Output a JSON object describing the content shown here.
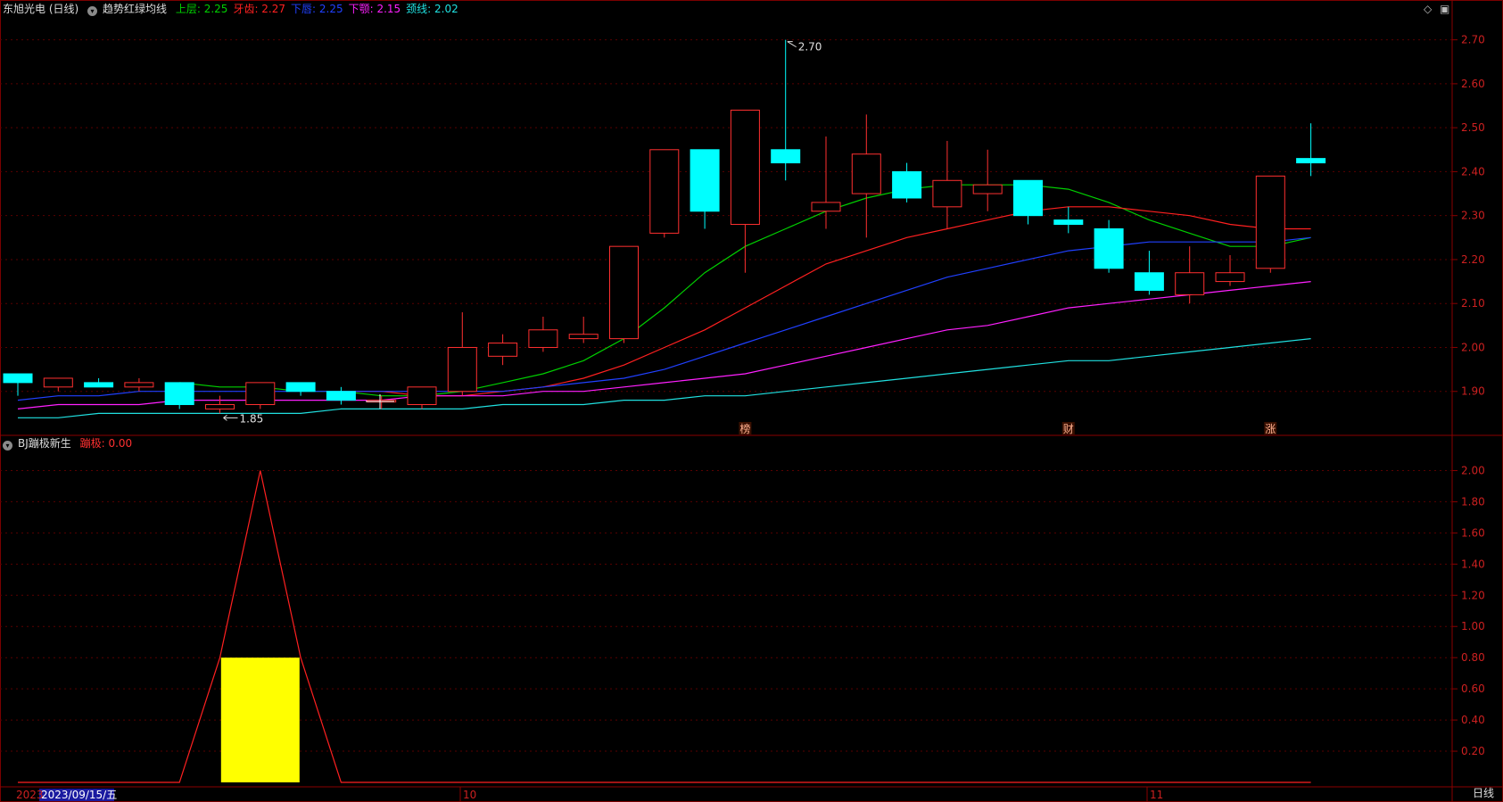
{
  "main_header": {
    "stock_name": "东旭光电 (日线)",
    "indicator_name": "趋势红绿均线",
    "lines": [
      {
        "label": "上层: 2.25",
        "color": "#00d000"
      },
      {
        "label": "牙齿: 2.27",
        "color": "#ff2020"
      },
      {
        "label": "下唇: 2.25",
        "color": "#2040ff"
      },
      {
        "label": "下颚: 2.15",
        "color": "#ff20ff"
      },
      {
        "label": "颈线: 2.02",
        "color": "#20e0e0"
      }
    ]
  },
  "sub_header": {
    "indicator_name": "BJ蹦极新生",
    "value_label": "蹦极: 0.00",
    "value_color": "#ff3030"
  },
  "x_labels": {
    "left_year": "2023",
    "cursor_date": "2023/09/15/五",
    "oct": "10",
    "nov": "11"
  },
  "period_label": "日线",
  "annotations": {
    "high": "2.70",
    "low": "1.85"
  },
  "event_markers": [
    {
      "text": "榜",
      "index": 18
    },
    {
      "text": "财",
      "index": 26
    },
    {
      "text": "涨",
      "index": 31
    }
  ],
  "chart_data": [
    {
      "type": "candlestick",
      "title": "东旭光电 (日线)",
      "ylim": [
        1.8,
        2.75
      ],
      "y_ticks": [
        1.9,
        2.0,
        2.1,
        2.2,
        2.3,
        2.4,
        2.5,
        2.6,
        2.7
      ],
      "colors": {
        "up": "#ff3030",
        "down": "#00ffff"
      },
      "candles": [
        {
          "o": 1.94,
          "h": 1.94,
          "l": 1.89,
          "c": 1.92
        },
        {
          "o": 1.91,
          "h": 1.93,
          "l": 1.9,
          "c": 1.93
        },
        {
          "o": 1.92,
          "h": 1.93,
          "l": 1.91,
          "c": 1.91
        },
        {
          "o": 1.91,
          "h": 1.93,
          "l": 1.9,
          "c": 1.92
        },
        {
          "o": 1.92,
          "h": 1.92,
          "l": 1.86,
          "c": 1.87
        },
        {
          "o": 1.86,
          "h": 1.89,
          "l": 1.85,
          "c": 1.87
        },
        {
          "o": 1.87,
          "h": 1.92,
          "l": 1.86,
          "c": 1.92
        },
        {
          "o": 1.92,
          "h": 1.92,
          "l": 1.89,
          "c": 1.9
        },
        {
          "o": 1.9,
          "h": 1.91,
          "l": 1.87,
          "c": 1.88
        },
        {
          "o": 1.88,
          "h": 1.89,
          "l": 1.86,
          "c": 1.88
        },
        {
          "o": 1.87,
          "h": 1.91,
          "l": 1.86,
          "c": 1.91
        },
        {
          "o": 1.9,
          "h": 2.08,
          "l": 1.89,
          "c": 2.0
        },
        {
          "o": 1.98,
          "h": 2.03,
          "l": 1.96,
          "c": 2.01
        },
        {
          "o": 2.0,
          "h": 2.07,
          "l": 1.99,
          "c": 2.04
        },
        {
          "o": 2.02,
          "h": 2.07,
          "l": 2.01,
          "c": 2.03
        },
        {
          "o": 2.02,
          "h": 2.23,
          "l": 2.01,
          "c": 2.23
        },
        {
          "o": 2.26,
          "h": 2.45,
          "l": 2.25,
          "c": 2.45
        },
        {
          "o": 2.45,
          "h": 2.45,
          "l": 2.27,
          "c": 2.31
        },
        {
          "o": 2.28,
          "h": 2.54,
          "l": 2.17,
          "c": 2.54
        },
        {
          "o": 2.45,
          "h": 2.7,
          "l": 2.38,
          "c": 2.42
        },
        {
          "o": 2.31,
          "h": 2.48,
          "l": 2.27,
          "c": 2.33
        },
        {
          "o": 2.35,
          "h": 2.53,
          "l": 2.25,
          "c": 2.44
        },
        {
          "o": 2.4,
          "h": 2.42,
          "l": 2.33,
          "c": 2.34
        },
        {
          "o": 2.32,
          "h": 2.47,
          "l": 2.27,
          "c": 2.38
        },
        {
          "o": 2.35,
          "h": 2.45,
          "l": 2.31,
          "c": 2.37
        },
        {
          "o": 2.38,
          "h": 2.38,
          "l": 2.28,
          "c": 2.3
        },
        {
          "o": 2.29,
          "h": 2.32,
          "l": 2.26,
          "c": 2.28
        },
        {
          "o": 2.27,
          "h": 2.29,
          "l": 2.17,
          "c": 2.18
        },
        {
          "o": 2.17,
          "h": 2.22,
          "l": 2.12,
          "c": 2.13
        },
        {
          "o": 2.12,
          "h": 2.23,
          "l": 2.1,
          "c": 2.17
        },
        {
          "o": 2.15,
          "h": 2.21,
          "l": 2.14,
          "c": 2.17
        },
        {
          "o": 2.18,
          "h": 2.39,
          "l": 2.17,
          "c": 2.39
        },
        {
          "o": 2.43,
          "h": 2.51,
          "l": 2.39,
          "c": 2.42
        }
      ],
      "series": [
        {
          "name": "上层",
          "color": "#00d000",
          "values": [
            null,
            null,
            null,
            null,
            1.92,
            1.91,
            1.91,
            1.9,
            1.9,
            1.89,
            1.89,
            1.9,
            1.92,
            1.94,
            1.97,
            2.02,
            2.09,
            2.17,
            2.23,
            2.27,
            2.31,
            2.34,
            2.36,
            2.37,
            2.37,
            2.37,
            2.36,
            2.33,
            2.29,
            2.26,
            2.23,
            2.23,
            2.25
          ]
        },
        {
          "name": "牙齿",
          "color": "#ff2020",
          "values": [
            null,
            null,
            null,
            null,
            null,
            null,
            null,
            null,
            1.9,
            1.9,
            1.89,
            1.89,
            1.9,
            1.91,
            1.93,
            1.96,
            2.0,
            2.04,
            2.09,
            2.14,
            2.19,
            2.22,
            2.25,
            2.27,
            2.29,
            2.31,
            2.32,
            2.32,
            2.31,
            2.3,
            2.28,
            2.27,
            2.27
          ]
        },
        {
          "name": "下唇",
          "color": "#2040ff",
          "values": [
            1.88,
            1.89,
            1.89,
            1.9,
            1.9,
            1.9,
            1.9,
            1.9,
            1.9,
            1.9,
            1.9,
            1.9,
            1.9,
            1.91,
            1.92,
            1.93,
            1.95,
            1.98,
            2.01,
            2.04,
            2.07,
            2.1,
            2.13,
            2.16,
            2.18,
            2.2,
            2.22,
            2.23,
            2.24,
            2.24,
            2.24,
            2.24,
            2.25
          ]
        },
        {
          "name": "下颚",
          "color": "#ff20ff",
          "values": [
            1.86,
            1.87,
            1.87,
            1.87,
            1.88,
            1.88,
            1.88,
            1.88,
            1.88,
            1.88,
            1.89,
            1.89,
            1.89,
            1.9,
            1.9,
            1.91,
            1.92,
            1.93,
            1.94,
            1.96,
            1.98,
            2.0,
            2.02,
            2.04,
            2.05,
            2.07,
            2.09,
            2.1,
            2.11,
            2.12,
            2.13,
            2.14,
            2.15
          ]
        },
        {
          "name": "颈线",
          "color": "#20e0e0",
          "values": [
            1.84,
            1.84,
            1.85,
            1.85,
            1.85,
            1.85,
            1.85,
            1.85,
            1.86,
            1.86,
            1.86,
            1.86,
            1.87,
            1.87,
            1.87,
            1.88,
            1.88,
            1.89,
            1.89,
            1.9,
            1.91,
            1.92,
            1.93,
            1.94,
            1.95,
            1.96,
            1.97,
            1.97,
            1.98,
            1.99,
            2.0,
            2.01,
            2.02
          ]
        }
      ]
    },
    {
      "type": "bar",
      "title": "BJ蹦极新生",
      "ylim": [
        0,
        2.1
      ],
      "y_ticks": [
        0.2,
        0.4,
        0.6,
        0.8,
        1.0,
        1.2,
        1.4,
        1.6,
        1.8,
        2.0
      ],
      "bars": [
        {
          "index": 6,
          "value": 0.8,
          "color": "#ffff00"
        }
      ],
      "line": {
        "name": "蹦极",
        "color": "#ff2020",
        "values": [
          0,
          0,
          0,
          0,
          0,
          0.8,
          2.0,
          0.8,
          0,
          0,
          0,
          0,
          0,
          0,
          0,
          0,
          0,
          0,
          0,
          0,
          0,
          0,
          0,
          0,
          0,
          0,
          0,
          0,
          0,
          0,
          0,
          0,
          0
        ]
      }
    }
  ]
}
